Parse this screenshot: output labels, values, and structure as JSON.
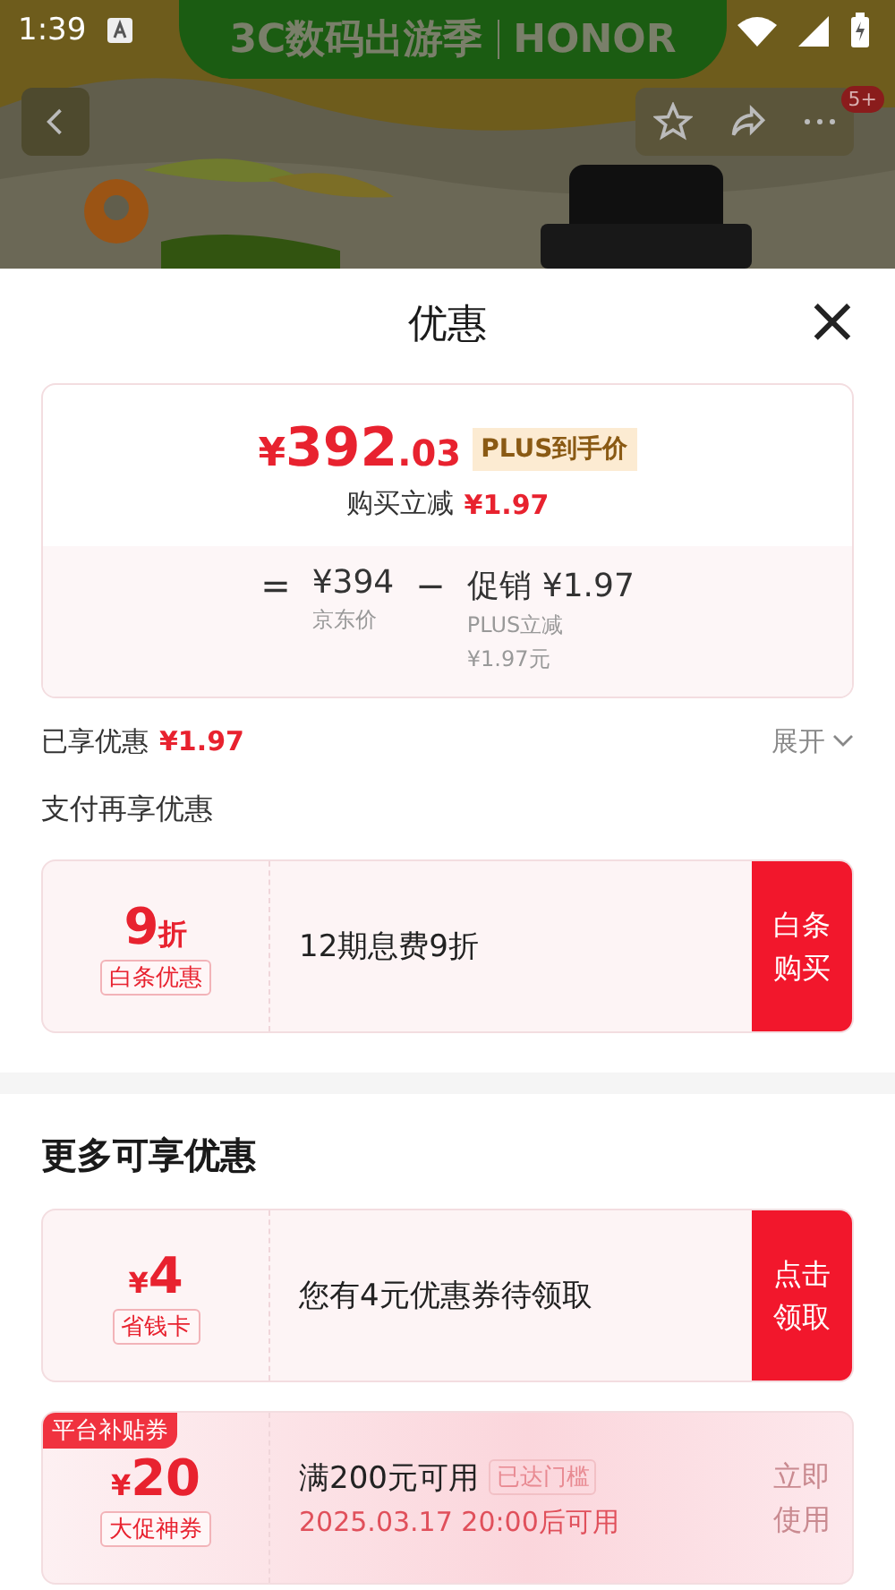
{
  "status_bar": {
    "time": "1:39"
  },
  "banner": {
    "title": "3C数码出游季",
    "brand": "HONOR",
    "badge": "5+"
  },
  "sheet": {
    "title": "优惠",
    "close": "×"
  },
  "price_card": {
    "currency": "¥",
    "integer": "392",
    "decimal": ".03",
    "tag": "PLUS到手价",
    "saving_label": "购买立减",
    "saving_value": "¥1.97",
    "equals": "=",
    "base_price": "¥394",
    "base_label": "京东价",
    "minus": "−",
    "promo_label": "促销",
    "promo_value": "¥1.97",
    "promo_detail": "PLUS立减",
    "promo_detail_value": "¥1.97元"
  },
  "enjoyed": {
    "label": "已享优惠",
    "value": "¥1.97",
    "toggle": "展开",
    "expanded": false
  },
  "pay_section": {
    "title": "支付再享优惠"
  },
  "pay_coupons": [
    {
      "kind": "standard",
      "amount": "9",
      "unit": "折",
      "type": "白条优惠",
      "description": "12期息费9折",
      "action": "白条购买"
    }
  ],
  "more_section": {
    "title": "更多可享优惠"
  },
  "more_coupons": [
    {
      "kind": "standard",
      "currency": "¥",
      "amount": "4",
      "type": "省钱卡",
      "description": "您有4元优惠券待领取",
      "action": "点击领取"
    },
    {
      "kind": "promo",
      "tag": "平台补贴券",
      "currency": "¥",
      "amount": "20",
      "type": "大促神券",
      "description": "满200元可用",
      "condition": "已达门槛",
      "note": "2025.03.17 20:00后可用",
      "action": "立即使用"
    }
  ]
}
